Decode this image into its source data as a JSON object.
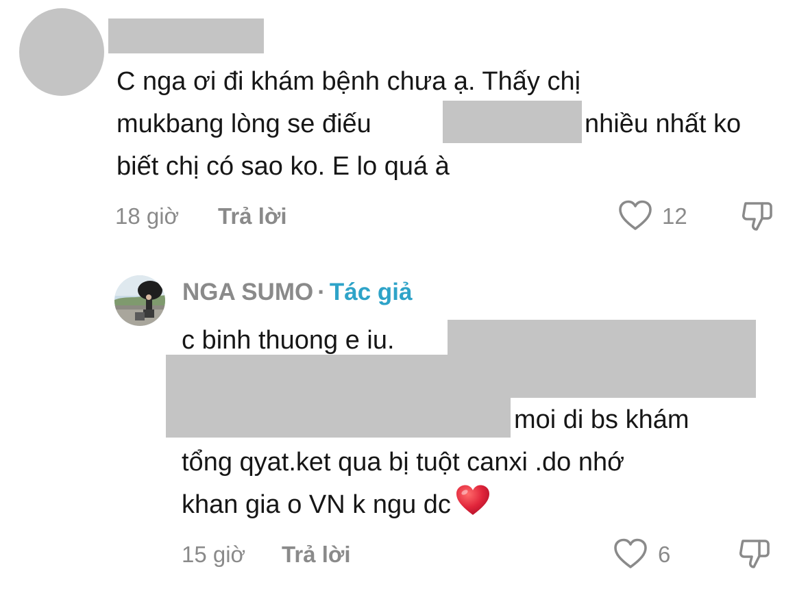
{
  "comment": {
    "text_line1": "C nga ơi đi khám bệnh chưa ạ. Thấy chị",
    "text_line2a": "mukbang lòng se điếu",
    "text_line2b": "nhiều nhất ko",
    "text_line3": "biết chị có sao ko. E lo quá à",
    "time": "18 giờ",
    "reply_label": "Trả lời",
    "likes": "12",
    "icons": {
      "like": "heart-outline-icon",
      "dislike": "thumbs-down-icon"
    }
  },
  "reply": {
    "author_name": "NGA SUMO",
    "separator": "·",
    "author_badge": "Tác giả",
    "text_line1": "c binh thuong e iu.",
    "text_line2": "moi di bs khám",
    "text_line3": "tổng qyat.ket qua bị tuột canxi .do nhớ",
    "text_line4": "khan gia o VN k ngu dc",
    "emoji": "red-heart-emoji",
    "time": "15 giờ",
    "reply_label": "Trả lời",
    "likes": "6",
    "icons": {
      "like": "heart-outline-icon",
      "dislike": "thumbs-down-icon"
    }
  },
  "colors": {
    "text": "#161616",
    "meta": "#8a8a8a",
    "author_badge": "#2ea3c8",
    "redaction": "#c4c4c4",
    "heart_emoji": "#e0243a"
  }
}
